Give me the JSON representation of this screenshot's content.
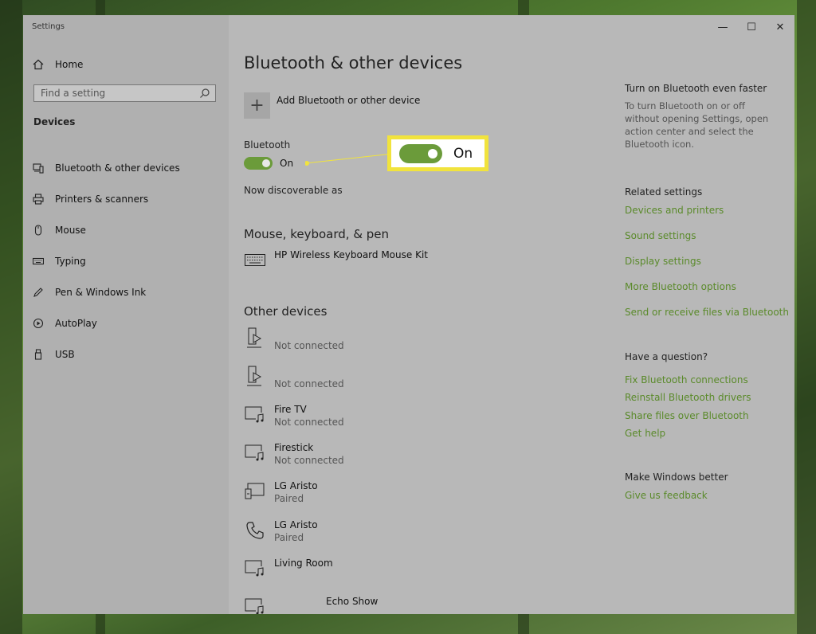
{
  "window": {
    "title": "Settings"
  },
  "sidebar": {
    "home_label": "Home",
    "search_placeholder": "Find a setting",
    "section": "Devices",
    "items": [
      {
        "label": "Bluetooth & other devices",
        "icon": "bluetooth-devices-icon"
      },
      {
        "label": "Printers & scanners",
        "icon": "printer-icon"
      },
      {
        "label": "Mouse",
        "icon": "mouse-icon"
      },
      {
        "label": "Typing",
        "icon": "keyboard-icon"
      },
      {
        "label": "Pen & Windows Ink",
        "icon": "pen-icon"
      },
      {
        "label": "AutoPlay",
        "icon": "autoplay-icon"
      },
      {
        "label": "USB",
        "icon": "usb-icon"
      }
    ]
  },
  "main": {
    "title": "Bluetooth & other devices",
    "add_device_label": "Add Bluetooth or other device",
    "bluetooth_label": "Bluetooth",
    "bluetooth_state": "On",
    "zoom_state": "On",
    "discoverable_text": "Now discoverable as",
    "mouse_section": "Mouse, keyboard, & pen",
    "keyboard_device": "HP Wireless Keyboard Mouse Kit",
    "other_section": "Other devices",
    "other_devices": [
      {
        "name": "",
        "status": "Not connected",
        "icon": "media-device-icon"
      },
      {
        "name": "",
        "status": "Not connected",
        "icon": "media-device-icon"
      },
      {
        "name": "Fire TV",
        "status": "Not connected",
        "icon": "media-music-icon"
      },
      {
        "name": "Firestick",
        "status": "Not connected",
        "icon": "media-music-icon"
      },
      {
        "name": "LG Aristo",
        "status": "Paired",
        "icon": "display-device-icon"
      },
      {
        "name": "LG Aristo",
        "status": "Paired",
        "icon": "phone-icon"
      },
      {
        "name": "Living Room",
        "status": "",
        "icon": "media-music-icon"
      },
      {
        "name": "Echo Show",
        "status": "",
        "icon": "media-music-icon"
      }
    ]
  },
  "right": {
    "faster_title": "Turn on Bluetooth even faster",
    "faster_text": "To turn Bluetooth on or off without opening Settings, open action center and select the Bluetooth icon.",
    "related_title": "Related settings",
    "related_links": [
      "Devices and printers",
      "Sound settings",
      "Display settings",
      "More Bluetooth options",
      "Send or receive files via Bluetooth"
    ],
    "question_title": "Have a question?",
    "question_links": [
      "Fix Bluetooth connections",
      "Reinstall Bluetooth drivers",
      "Share files over Bluetooth",
      "Get help"
    ],
    "better_title": "Make Windows better",
    "feedback_link": "Give us feedback"
  },
  "colors": {
    "link": "#5a8a2a",
    "toggle": "#6b9b3a",
    "highlight": "#f1e33d"
  }
}
